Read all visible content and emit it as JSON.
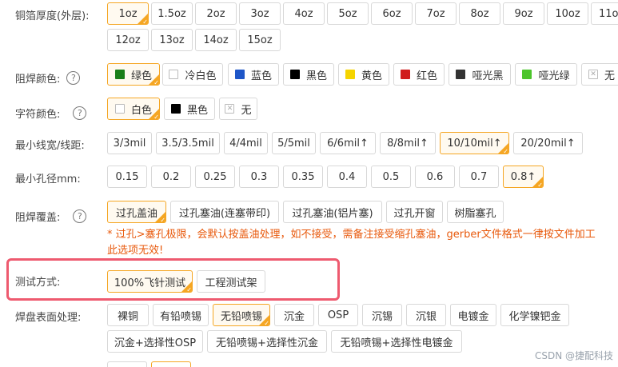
{
  "copper": {
    "label": "铜箔厚度(外层):",
    "options": [
      "1oz",
      "1.5oz",
      "2oz",
      "3oz",
      "4oz",
      "5oz",
      "6oz",
      "7oz",
      "8oz",
      "9oz",
      "10oz",
      "11o",
      "12oz",
      "13oz",
      "14oz",
      "15oz"
    ],
    "selected": "1oz"
  },
  "solder_mask": {
    "label": "阻焊颜色:",
    "help": "?",
    "options": [
      {
        "text": "绿色",
        "color": "#1a7f1a"
      },
      {
        "text": "冷白色",
        "color": "#ffffff"
      },
      {
        "text": "蓝色",
        "color": "#1e56c8"
      },
      {
        "text": "黑色",
        "color": "#000000"
      },
      {
        "text": "黄色",
        "color": "#f5d400"
      },
      {
        "text": "红色",
        "color": "#d01c1c"
      },
      {
        "text": "哑光黑",
        "color": "#333333"
      },
      {
        "text": "哑光绿",
        "color": "#4cc52c"
      },
      {
        "text": "无",
        "color": "none"
      }
    ],
    "selected": "绿色"
  },
  "silkscreen": {
    "label": "字符颜色:",
    "help": "?",
    "options": [
      {
        "text": "白色",
        "color": "#ffffff"
      },
      {
        "text": "黑色",
        "color": "#000000"
      },
      {
        "text": "无",
        "color": "none"
      }
    ],
    "selected": "白色"
  },
  "trace": {
    "label": "最小线宽/线距:",
    "options": [
      "3/3mil",
      "3.5/3.5mil",
      "4/4mil",
      "5/5mil",
      "6/6mil↑",
      "8/8mil↑",
      "10/10mil↑",
      "20/20mil↑"
    ],
    "selected": "10/10mil↑"
  },
  "hole": {
    "label": "最小孔径mm:",
    "options": [
      "0.15",
      "0.2",
      "0.25",
      "0.3",
      "0.35",
      "0.4",
      "0.5",
      "0.6",
      "0.7",
      "0.8↑"
    ],
    "selected": "0.8↑"
  },
  "via": {
    "label": "阻焊覆盖:",
    "help": "?",
    "options": [
      "过孔盖油",
      "过孔塞油(连塞带印)",
      "过孔塞油(铝片塞)",
      "过孔开窗",
      "树脂塞孔"
    ],
    "selected": "过孔盖油",
    "note_line1": "* 过孔>塞孔极限，会默认按盖油处理，如不接受，需备注接受缩孔塞油，gerber文件格式一律按文件加工",
    "note_line2": "此选项无效!"
  },
  "test": {
    "label": "测试方式:",
    "options": [
      "100%飞针测试",
      "工程测试架"
    ],
    "selected": "100%飞针测试"
  },
  "finish": {
    "label": "焊盘表面处理:",
    "options": [
      "裸铜",
      "有铅喷锡",
      "无铅喷锡",
      "沉金",
      "OSP",
      "沉锡",
      "沉银",
      "电镀金",
      "化学镍钯金",
      "沉金+选择性OSP",
      "无铅喷锡+选择性沉金",
      "无铅喷锡+选择性电镀金"
    ],
    "selected": "无铅喷锡"
  },
  "watermark": "CSDN @捷配科技"
}
